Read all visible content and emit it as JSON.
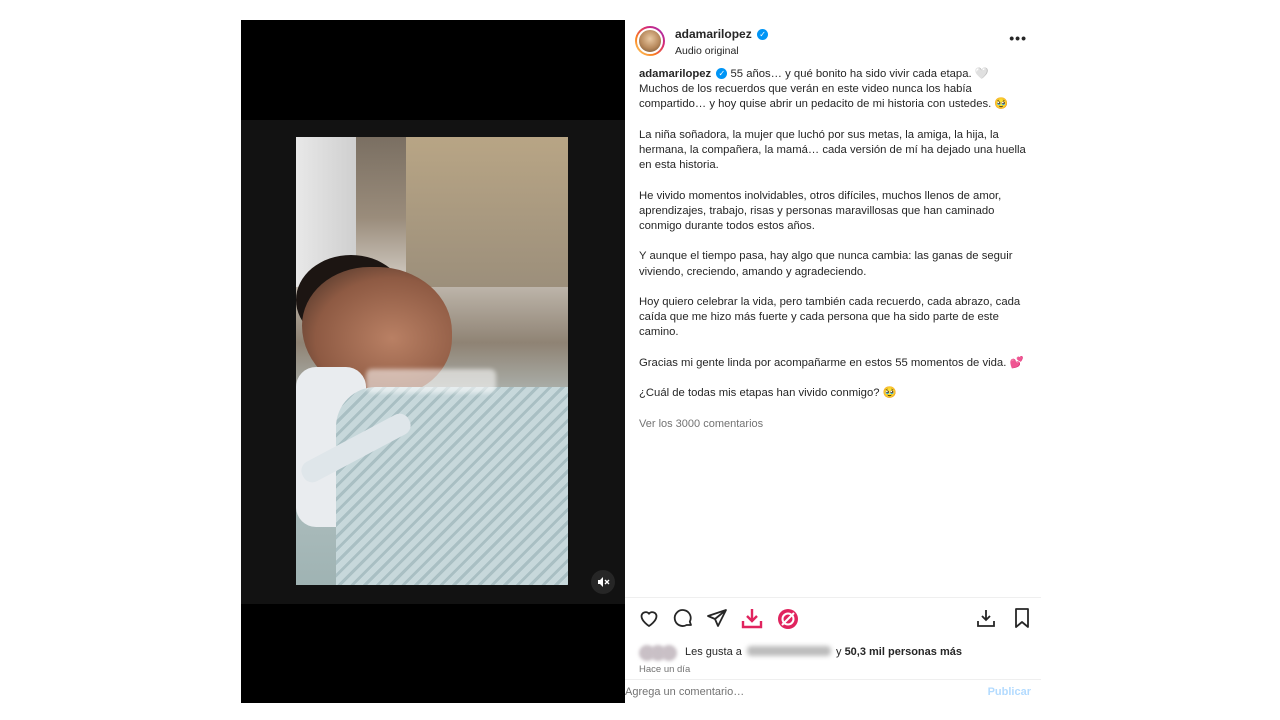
{
  "post": {
    "username": "adamarilopez",
    "audio_label": "Audio original",
    "more_label": "•••",
    "caption": {
      "username": "adamarilopez",
      "paragraphs": [
        "55 años… y qué bonito ha sido vivir cada etapa. 🤍 Muchos de los recuerdos que verán en este video nunca los había compartido… y hoy quise abrir un pedacito de mi historia con ustedes. 🥹",
        "La niña soñadora, la mujer que luchó por sus metas, la amiga, la hija, la hermana, la compañera, la mamá… cada versión de mí ha dejado una huella en esta historia.",
        "He vivido momentos inolvidables, otros difíciles, muchos llenos de amor, aprendizajes, trabajo, risas y personas maravillosas que han caminado conmigo durante todos estos años.",
        "Y aunque el tiempo pasa, hay algo que nunca cambia: las ganas de seguir viviendo, creciendo, amando y agradeciendo.",
        "Hoy quiero celebrar la vida, pero también cada recuerdo, cada abrazo, cada caída que me hizo más fuerte y cada persona que ha sido parte de este camino.",
        "Gracias mi gente linda por acompañarme en estos 55 momentos de vida. 💕",
        "¿Cuál de todas mis etapas han vivido conmigo? 🥹"
      ]
    },
    "comments_link": "Ver los 3000 comentarios",
    "likes": {
      "prefix": "Les gusta a",
      "connector": "y",
      "count_text": "50,3 mil personas más"
    },
    "time_ago": "Hace un día",
    "comment_placeholder": "Agrega un comentario…",
    "publish_label": "Publicar"
  },
  "media": {
    "mute_icon": "speaker-muted-icon"
  },
  "icons": {
    "like": "heart-icon",
    "comment": "comment-icon",
    "share": "send-icon",
    "ext_download": "red-download-icon",
    "ext_block": "red-block-icon",
    "download": "download-icon",
    "save": "bookmark-icon"
  },
  "colors": {
    "accent_red": "#e0245e",
    "link_blue": "#0095f6",
    "publish_disabled": "#b3dbff"
  }
}
